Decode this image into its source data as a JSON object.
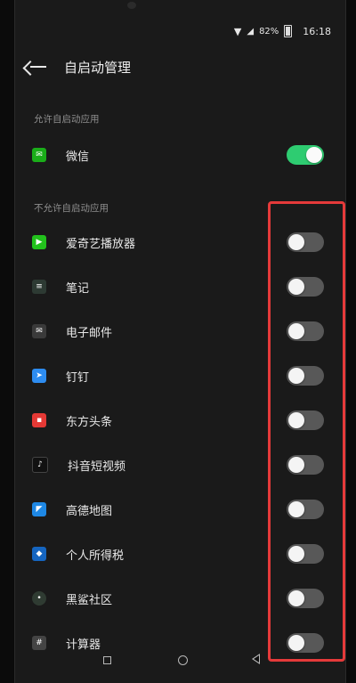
{
  "status": {
    "battery": "82%",
    "time": "16:18"
  },
  "header": {
    "title": "自启动管理"
  },
  "sections": {
    "allowed": "允许自启动应用",
    "disallowed": "不允许自启动应用"
  },
  "apps": [
    {
      "name": "微信",
      "enabled": true,
      "icon": "wechat-icon",
      "color": "#1aad19"
    },
    {
      "name": "爱奇艺播放器",
      "enabled": false,
      "icon": "iqiyi-icon",
      "color": "#22c11c"
    },
    {
      "name": "笔记",
      "enabled": false,
      "icon": "notes-icon",
      "color": "#2d3a33"
    },
    {
      "name": "电子邮件",
      "enabled": false,
      "icon": "email-icon",
      "color": "#3a3a3a"
    },
    {
      "name": "钉钉",
      "enabled": false,
      "icon": "dingtalk-icon",
      "color": "#2d8cf0"
    },
    {
      "name": "东方头条",
      "enabled": false,
      "icon": "dongfang-icon",
      "color": "#e53935"
    },
    {
      "name": "抖音短视频",
      "enabled": false,
      "icon": "douyin-icon",
      "color": "#111111"
    },
    {
      "name": "高德地图",
      "enabled": false,
      "icon": "amap-icon",
      "color": "#1e88e5"
    },
    {
      "name": "个人所得税",
      "enabled": false,
      "icon": "tax-icon",
      "color": "#1565c0"
    },
    {
      "name": "黑鲨社区",
      "enabled": false,
      "icon": "blackshark-icon",
      "color": "#2f3b32"
    },
    {
      "name": "计算器",
      "enabled": false,
      "icon": "calculator-icon",
      "color": "#444444"
    }
  ]
}
